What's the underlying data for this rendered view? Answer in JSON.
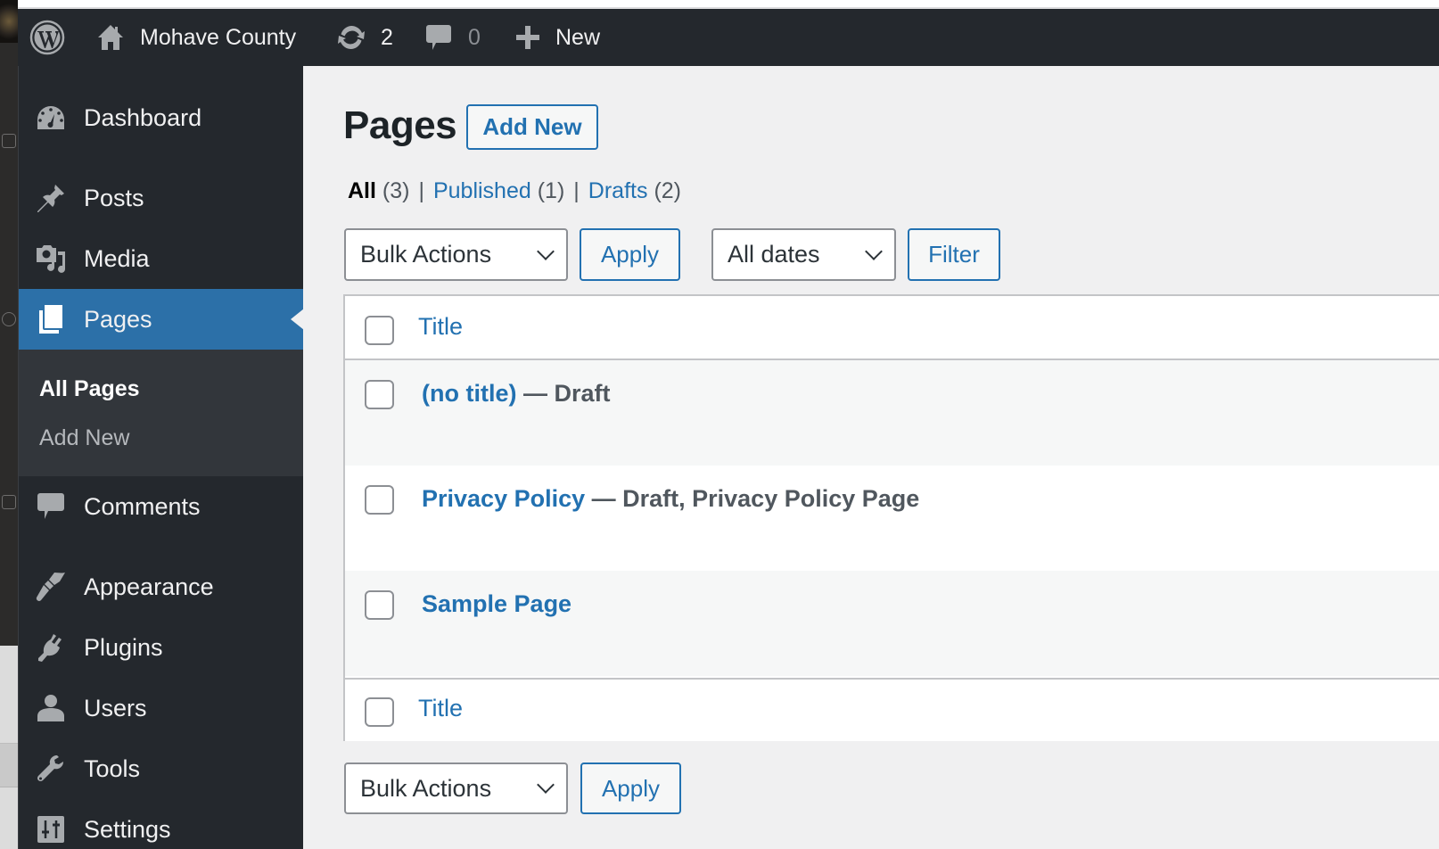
{
  "adminbar": {
    "site_name": "Mohave County",
    "updates_count": "2",
    "comments_count": "0",
    "new_label": "New"
  },
  "sidebar": {
    "items": [
      {
        "label": "Dashboard",
        "icon": "dashboard-icon"
      },
      {
        "label": "Posts",
        "icon": "pin-icon"
      },
      {
        "label": "Media",
        "icon": "media-icon"
      },
      {
        "label": "Pages",
        "icon": "pages-icon",
        "active": true
      },
      {
        "label": "Comments",
        "icon": "comment-icon"
      },
      {
        "label": "Appearance",
        "icon": "paintbrush-icon"
      },
      {
        "label": "Plugins",
        "icon": "plugin-icon"
      },
      {
        "label": "Users",
        "icon": "user-icon"
      },
      {
        "label": "Tools",
        "icon": "wrench-icon"
      },
      {
        "label": "Settings",
        "icon": "settings-icon"
      }
    ],
    "submenu": [
      {
        "label": "All Pages",
        "current": true
      },
      {
        "label": "Add New"
      }
    ]
  },
  "main": {
    "title": "Pages",
    "add_new_label": "Add New",
    "views": {
      "all_label": "All",
      "all_count": "(3)",
      "published_label": "Published",
      "published_count": "(1)",
      "drafts_label": "Drafts",
      "drafts_count": "(2)",
      "separator": "|"
    },
    "bulk_actions_top": "Bulk Actions",
    "apply_label": "Apply",
    "date_filter": "All dates",
    "filter_label": "Filter",
    "bulk_actions_bottom": "Bulk Actions",
    "table": {
      "column_title": "Title",
      "rows": [
        {
          "title": "(no title)",
          "state": " — Draft"
        },
        {
          "title": "Privacy Policy",
          "state": " — Draft, Privacy Policy Page"
        },
        {
          "title": "Sample Page",
          "state": ""
        }
      ]
    }
  },
  "colors": {
    "accent": "#2271b1",
    "menu_active": "#2c70a8",
    "adminbar_bg": "#24282d",
    "content_bg": "#f0f0f1"
  }
}
